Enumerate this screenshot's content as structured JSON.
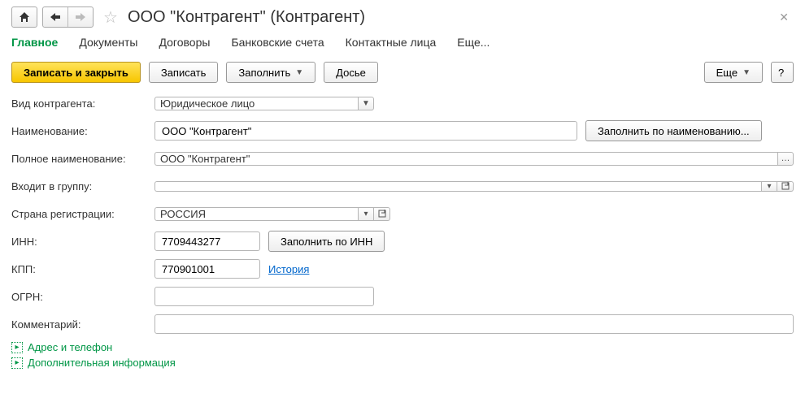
{
  "header": {
    "title": "ООО \"Контрагент\" (Контрагент)"
  },
  "tabs": {
    "main": "Главное",
    "documents": "Документы",
    "contracts": "Договоры",
    "bank": "Банковские счета",
    "contacts": "Контактные лица",
    "more": "Еще..."
  },
  "toolbar": {
    "save_close": "Записать и закрыть",
    "save": "Записать",
    "fill": "Заполнить",
    "dossier": "Досье",
    "more": "Еще",
    "help": "?"
  },
  "form": {
    "kind_label": "Вид контрагента:",
    "kind_value": "Юридическое лицо",
    "name_label": "Наименование:",
    "name_value": "ООО \"Контрагент\"",
    "fill_by_name": "Заполнить по наименованию...",
    "full_name_label": "Полное наименование:",
    "full_name_value": "ООО \"Контрагент\"",
    "group_label": "Входит в группу:",
    "group_value": "",
    "country_label": "Страна регистрации:",
    "country_value": "РОССИЯ",
    "inn_label": "ИНН:",
    "inn_value": "7709443277",
    "fill_by_inn": "Заполнить по ИНН",
    "kpp_label": "КПП:",
    "kpp_value": "770901001",
    "history_link": "История",
    "ogrn_label": "ОГРН:",
    "ogrn_value": "",
    "comment_label": "Комментарий:",
    "comment_value": ""
  },
  "sections": {
    "address": "Адрес и телефон",
    "extra": "Дополнительная информация"
  }
}
